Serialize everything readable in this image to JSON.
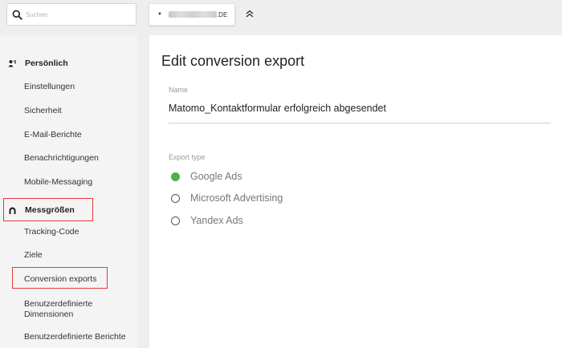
{
  "search": {
    "placeholder": "Suchen"
  },
  "site_selector": {
    "domain_suffix": ".DE"
  },
  "sidebar": {
    "sections": [
      {
        "title": "Persönlich",
        "items": [
          "Einstellungen",
          "Sicherheit",
          "E-Mail-Berichte",
          "Benachrichtigungen",
          "Mobile-Messaging"
        ]
      },
      {
        "title": "Messgrößen",
        "items": [
          "Tracking-Code",
          "Ziele",
          "Conversion exports",
          "Benutzerdefinierte Dimensionen",
          "Benutzerdefinierte Berichte"
        ]
      }
    ]
  },
  "main": {
    "title": "Edit conversion export",
    "name_label": "Name",
    "name_value": "Matomo_Kontaktformular erfolgreich abgesendet",
    "export_type_label": "Export type",
    "export_types": [
      {
        "label": "Google Ads",
        "selected": true
      },
      {
        "label": "Microsoft Advertising",
        "selected": false
      },
      {
        "label": "Yandex Ads",
        "selected": false
      }
    ]
  },
  "colors": {
    "selected_radio": "#4caf50",
    "highlight_box": "#e53935"
  }
}
